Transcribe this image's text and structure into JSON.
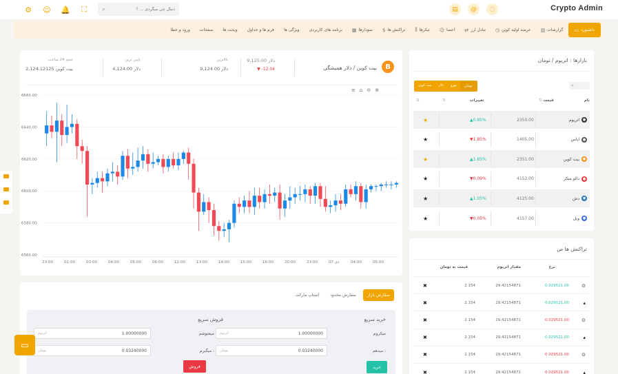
{
  "brand": "Crypto Admin",
  "search": {
    "placeholder": "دنبال چی میگردی ... ؟"
  },
  "nav": [
    {
      "label": "داشبورد",
      "icon": "monitor-icon",
      "active": true
    },
    {
      "label": "گزارشات",
      "icon": "bar-chart-icon"
    },
    {
      "label": "عرضه اولیه کوین",
      "icon": "clock-icon"
    },
    {
      "label": "تبادل ارز",
      "icon": "exchange-icon"
    },
    {
      "label": "اعضا",
      "icon": "users-icon"
    },
    {
      "label": "تیکرها",
      "icon": "sliders-icon"
    },
    {
      "label": "تراکنش ها",
      "icon": "dollar-icon"
    },
    {
      "label": "نمودارها",
      "icon": "chart-icon"
    },
    {
      "label": "برنامه های کاربردی",
      "icon": "grid-icon"
    },
    {
      "label": "ویژگی ها",
      "icon": "feature-icon"
    },
    {
      "label": "فرم ها و جداول",
      "icon": "form-icon"
    },
    {
      "label": "ویجت ها",
      "icon": "widget-icon"
    },
    {
      "label": "صفحات",
      "icon": "page-icon"
    },
    {
      "label": "ورود و خطا",
      "icon": "login-icon"
    }
  ],
  "ticker": {
    "pair": "بیت کوین / دلار همیشگی",
    "price": "9,125.00 دلار",
    "change": "-12.04",
    "high_label": "بالاترین",
    "high": "9,124.00 دلار",
    "low_label": "پایین ترین",
    "low": "4,124.00 دلار",
    "vol_label": "حجم 24 ساعت",
    "vol": "2,124.12125 بیت کوین"
  },
  "chart_data": {
    "type": "candlestick",
    "yticks": [
      "6660.00",
      "6640.00",
      "6620.00",
      "6600.00",
      "6580.00",
      "6560.00"
    ],
    "xticks": [
      "23:00",
      "02:00",
      "03:00",
      "04:00",
      "05:00",
      "06:00",
      "12:00",
      "13:00",
      "14:00",
      "15:00",
      "16:00",
      "20:00",
      "23:00",
      "دی 07",
      "04:00",
      "05:00"
    ],
    "ylim": [
      6560,
      6660
    ],
    "candles": [
      [
        6636,
        6641,
        6628,
        6650
      ],
      [
        6641,
        6637,
        6633,
        6647
      ],
      [
        6637,
        6644,
        6618,
        6655
      ],
      [
        6644,
        6635,
        6628,
        6648
      ],
      [
        6635,
        6640,
        6630,
        6654
      ],
      [
        6640,
        6642,
        6636,
        6648
      ],
      [
        6642,
        6628,
        6620,
        6645
      ],
      [
        6628,
        6625,
        6617,
        6632
      ],
      [
        6625,
        6604,
        6584,
        6628
      ],
      [
        6604,
        6605,
        6598,
        6608
      ],
      [
        6605,
        6608,
        6602,
        6612
      ],
      [
        6608,
        6606,
        6599,
        6612
      ],
      [
        6606,
        6611,
        6603,
        6614
      ],
      [
        6611,
        6612,
        6606,
        6618
      ],
      [
        6612,
        6609,
        6604,
        6616
      ],
      [
        6609,
        6622,
        6607,
        6625
      ],
      [
        6622,
        6614,
        6608,
        6626
      ],
      [
        6614,
        6615,
        6610,
        6624
      ],
      [
        6615,
        6619,
        6612,
        6627
      ],
      [
        6619,
        6623,
        6614,
        6628
      ],
      [
        6623,
        6617,
        6612,
        6626
      ],
      [
        6617,
        6618,
        6614,
        6624
      ],
      [
        6618,
        6620,
        6616,
        6622
      ],
      [
        6620,
        6615,
        6611,
        6623
      ],
      [
        6615,
        6620,
        6612,
        6622
      ],
      [
        6620,
        6616,
        6614,
        6624
      ],
      [
        6616,
        6620,
        6613,
        6624
      ],
      [
        6620,
        6624,
        6617,
        6625
      ],
      [
        6624,
        6617,
        6607,
        6627
      ],
      [
        6617,
        6599,
        6589,
        6620
      ],
      [
        6599,
        6587,
        6575,
        6602
      ],
      [
        6587,
        6593,
        6585,
        6598
      ],
      [
        6593,
        6588,
        6580,
        6596
      ],
      [
        6588,
        6578,
        6572,
        6592
      ],
      [
        6578,
        6575,
        6569,
        6581
      ],
      [
        6575,
        6576,
        6571,
        6580
      ],
      [
        6576,
        6580,
        6568,
        6582
      ],
      [
        6580,
        6592,
        6577,
        6594
      ],
      [
        6592,
        6590,
        6586,
        6596
      ],
      [
        6590,
        6594,
        6586,
        6597
      ],
      [
        6594,
        6590,
        6586,
        6600
      ],
      [
        6590,
        6597,
        6585,
        6602
      ],
      [
        6597,
        6593,
        6589,
        6602
      ],
      [
        6593,
        6598,
        6589,
        6601
      ],
      [
        6598,
        6597,
        6592,
        6604
      ],
      [
        6597,
        6599,
        6593,
        6602
      ],
      [
        6599,
        6589,
        6582,
        6604
      ],
      [
        6589,
        6594,
        6584,
        6598
      ],
      [
        6594,
        6596,
        6589,
        6603
      ],
      [
        6596,
        6598,
        6592,
        6602
      ],
      [
        6598,
        6598,
        6594,
        6603
      ],
      [
        6598,
        6601,
        6593,
        6604
      ],
      [
        6601,
        6597,
        6592,
        6603
      ],
      [
        6597,
        6603,
        6592,
        6605
      ],
      [
        6603,
        6595,
        6590,
        6605
      ],
      [
        6595,
        6590,
        6587,
        6603
      ],
      [
        6590,
        6591,
        6586,
        6594
      ],
      [
        6591,
        6594,
        6587,
        6598
      ],
      [
        6594,
        6592,
        6588,
        6598
      ],
      [
        6592,
        6601,
        6590,
        6604
      ],
      [
        6601,
        6598,
        6596,
        6604
      ],
      [
        6598,
        6603,
        6594,
        6606
      ],
      [
        6603,
        6593,
        6589,
        6605
      ],
      [
        6593,
        6601,
        6589,
        6604
      ],
      [
        6601,
        6603,
        6599,
        6604
      ],
      [
        6603,
        6603,
        6600,
        6604
      ],
      [
        6603,
        6604,
        6600,
        6605
      ],
      [
        6604,
        6604,
        6602,
        6606
      ],
      [
        6604,
        6604,
        6601,
        6606
      ],
      [
        6604,
        6605,
        6602,
        6606
      ]
    ]
  },
  "chart_tools": [
    "zoom-in-icon",
    "zoom-out-icon",
    "home-icon",
    "menu-icon"
  ],
  "trade": {
    "tabs": [
      "سفارش بازار",
      "سفارش محدود",
      "استاپ مارکت"
    ],
    "buy_title": "خرید سریع",
    "sell_title": "فروش سریع",
    "amount_label": "مبلغ :",
    "qty_label": "میشوشم",
    "buy_amount_label": "میکروم",
    "buy_qty_label": "میدهم :",
    "sell_amount_label": "میگیرم :",
    "unit_eth": "اتریوم",
    "unit_toman": "تومان",
    "val1": "1.00000000",
    "val2": "0.03240000",
    "buy_btn": "خرید",
    "sell_btn": "فروش"
  },
  "markets": {
    "title": "بازارها : اتریوم / تومان",
    "coin_tabs": [
      "تومان",
      "یورو",
      "دلار",
      "بیت کوین"
    ],
    "headers": {
      "name": "نام",
      "price": "قیمت",
      "change": "تغییرات"
    },
    "rows": [
      {
        "name": "اتریوم",
        "price": "2350.00",
        "change": "0.85%",
        "dir": "up",
        "starred": true,
        "color": "#333"
      },
      {
        "name": "ایاس",
        "price": "1405.00",
        "change": "1.85%",
        "dir": "down",
        "starred": false,
        "color": "#555"
      },
      {
        "name": "بیت کوین",
        "price": "2351.00",
        "change": "1.85%",
        "dir": "up",
        "starred": true,
        "color": "#f7931a"
      },
      {
        "name": "دالو میکر",
        "price": "4152.00",
        "change": "0.09%",
        "dir": "down",
        "starred": false,
        "color": "#ea3943"
      },
      {
        "name": "دش",
        "price": "4125.00",
        "change": "1.05%",
        "dir": "up",
        "starred": false,
        "color": "#1c75bc"
      },
      {
        "name": "ویل",
        "price": "4157.00",
        "change": "0.05%",
        "dir": "down",
        "starred": false,
        "color": "#3a6fd8"
      }
    ]
  },
  "transactions": {
    "title": "تراکنش ها ص",
    "headers": {
      "rate": "نرخ",
      "amount": "مقدار اتریوم",
      "total": "قیمت به تومان"
    },
    "rows": [
      {
        "rate": "0.029521.00",
        "amount": "29.42154871",
        "total": "2.154",
        "rate_dir": "up",
        "icon": "circle-icon"
      },
      {
        "rate": "0.029521.00",
        "amount": "29.42154871",
        "total": "2.154",
        "rate_dir": "up",
        "icon": "caret-up-icon"
      },
      {
        "rate": "0.029521.00",
        "amount": "29.42154871",
        "total": "2.154",
        "rate_dir": "down",
        "icon": "circle-icon"
      },
      {
        "rate": "0.029521.00",
        "amount": "29.42154871",
        "total": "2.154",
        "rate_dir": "up",
        "icon": "caret-up-icon"
      },
      {
        "rate": "0.029521.00",
        "amount": "29.42154871",
        "total": "2.154",
        "rate_dir": "down",
        "icon": "circle-icon"
      },
      {
        "rate": "0.029521.00",
        "amount": "29.42154871",
        "total": "2.154",
        "rate_dir": "down",
        "icon": "caret-up-icon"
      }
    ]
  },
  "colors": {
    "accent": "#f0a500",
    "up": "#23c1a6",
    "down": "#ea3943"
  }
}
